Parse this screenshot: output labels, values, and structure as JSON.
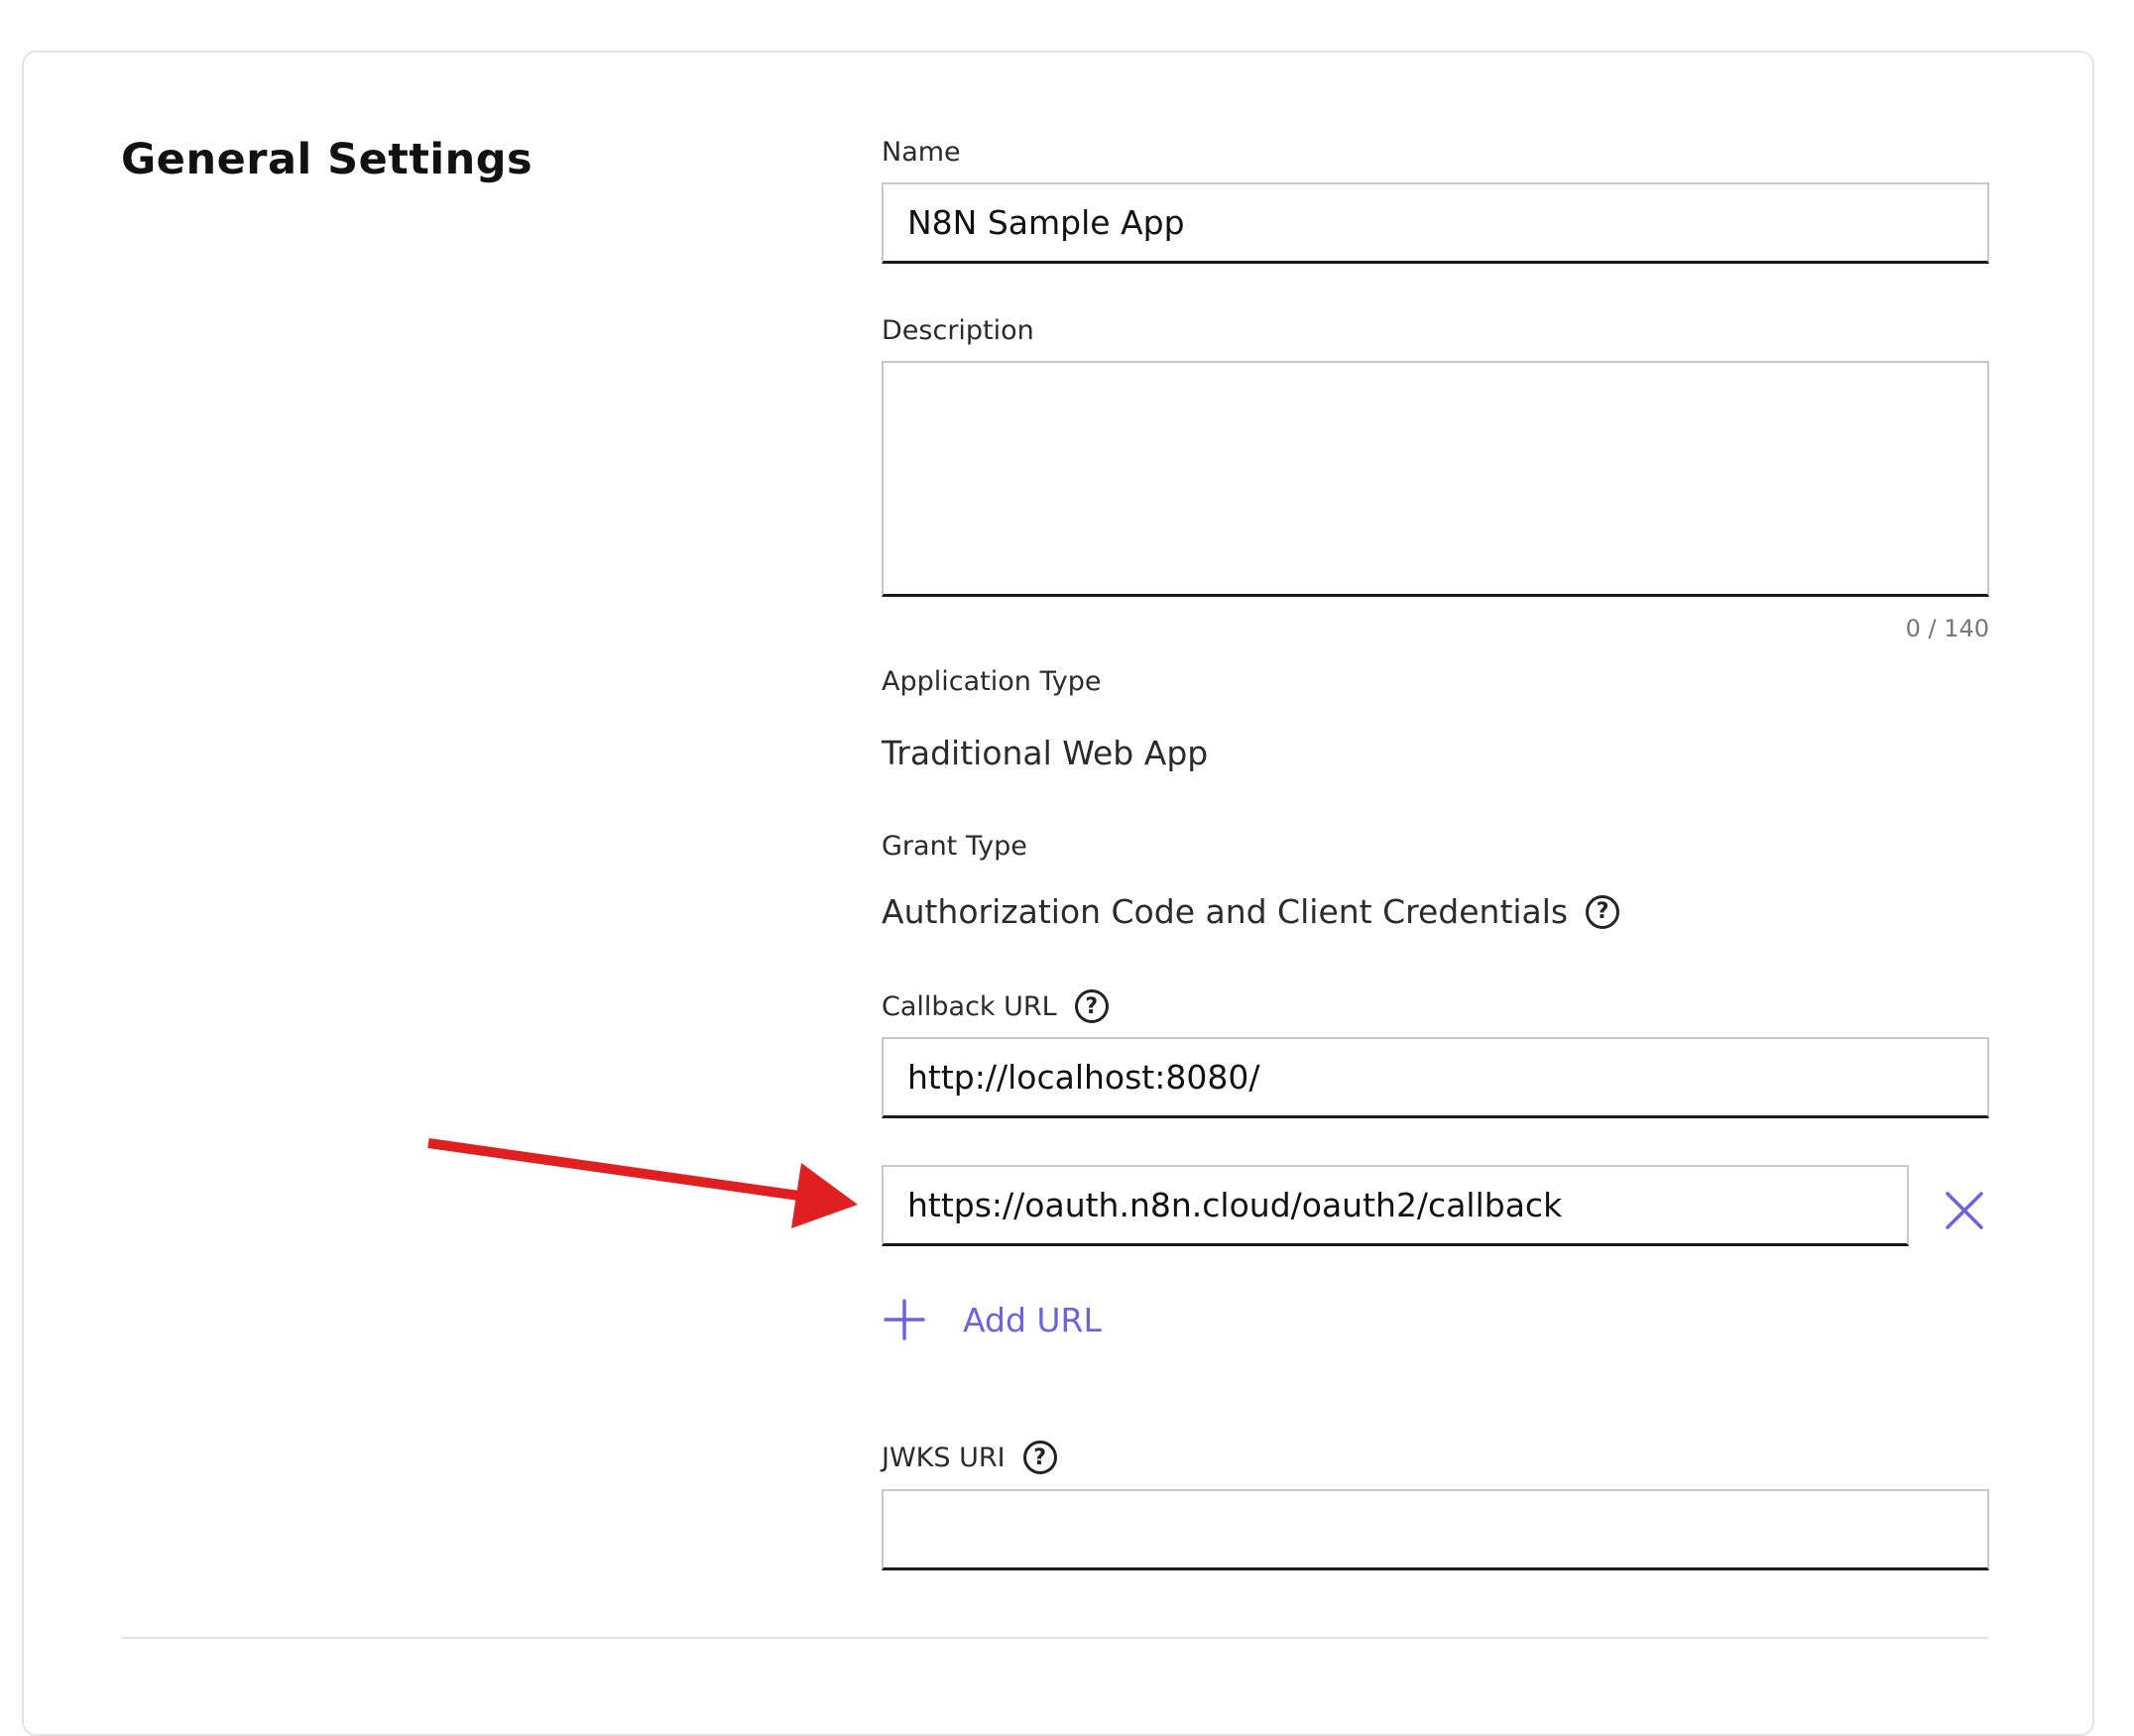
{
  "section": {
    "title": "General Settings"
  },
  "name": {
    "label": "Name",
    "value": "N8N Sample App"
  },
  "description": {
    "label": "Description",
    "value": "",
    "counter": "0 / 140"
  },
  "application_type": {
    "label": "Application Type",
    "value": "Traditional Web App"
  },
  "grant_type": {
    "label": "Grant Type",
    "value": "Authorization Code and Client Credentials"
  },
  "callback": {
    "label": "Callback URL",
    "urls": [
      "http://localhost:8080/",
      "https://oauth.n8n.cloud/oauth2/callback"
    ],
    "add_label": "Add URL"
  },
  "jwks": {
    "label": "JWKS URI",
    "value": ""
  },
  "colors": {
    "accent": "#6b63e0",
    "annotation_arrow": "#e02020"
  },
  "icons": [
    "help-icon",
    "close-icon",
    "plus-icon",
    "annotation-arrow"
  ]
}
